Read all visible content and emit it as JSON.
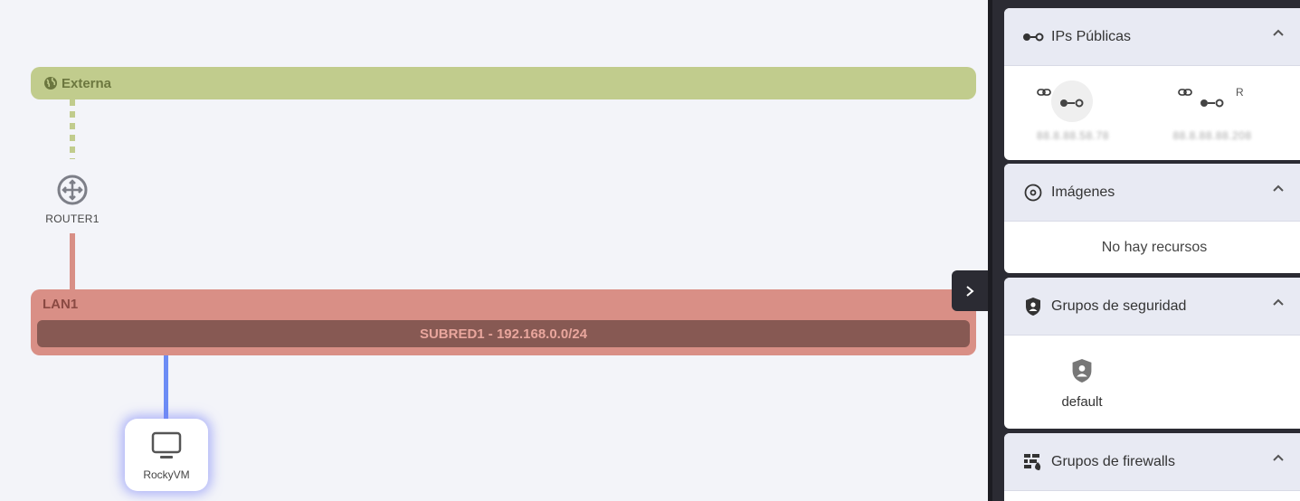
{
  "canvas": {
    "external_network": {
      "label": "Externa"
    },
    "router": {
      "label": "ROUTER1"
    },
    "lan": {
      "label": "LAN1",
      "subnet": "SUBRED1 - 192.168.0.0/24"
    },
    "vm": {
      "label": "RockyVM"
    },
    "colors": {
      "external": "#c1cc8d",
      "lan": "#d98f86",
      "subnet": "#875953",
      "vm_link": "#6c8cf5"
    }
  },
  "sidebar": {
    "public_ips": {
      "title": "IPs Públicas",
      "items": [
        {
          "address": "88.8.88.58.78",
          "badge": ""
        },
        {
          "address": "88.8.88.88.208",
          "badge": "R"
        }
      ]
    },
    "images": {
      "title": "Imágenes",
      "empty_text": "No hay recursos"
    },
    "security_groups": {
      "title": "Grupos de seguridad",
      "items": [
        {
          "label": "default"
        }
      ]
    },
    "firewall_groups": {
      "title": "Grupos de firewalls"
    }
  }
}
